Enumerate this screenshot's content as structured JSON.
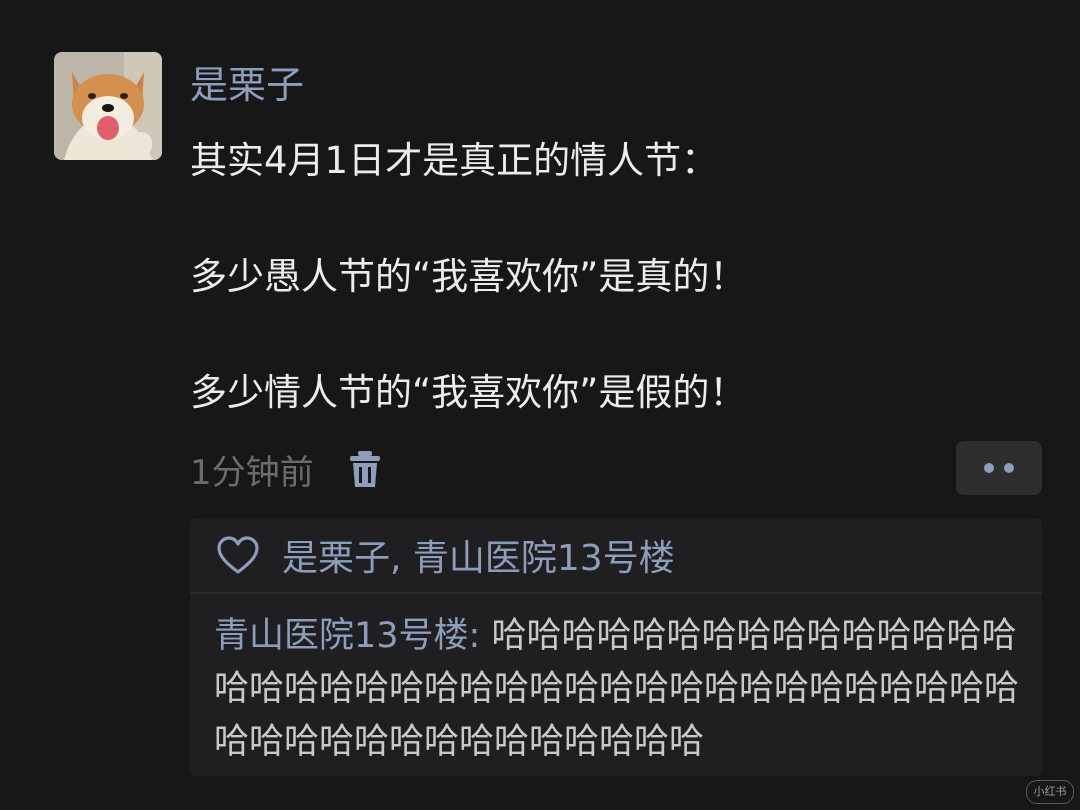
{
  "post": {
    "author": "是栗子",
    "lines": [
      "其实4月1日才是真正的情人节：",
      "",
      "多少愚人节的“我喜欢你”是真的！",
      "",
      "多少情人节的“我喜欢你”是假的！"
    ],
    "time": "1分钟前",
    "avatar_icon": "shiba-dog-avatar",
    "delete_icon": "trash-icon",
    "more_icon": "more-dots-icon"
  },
  "likes": {
    "icon": "heart-icon",
    "names": "是栗子, 青山医院13号楼"
  },
  "comment": {
    "author": "青山医院13号楼",
    "separator": ": ",
    "text": "哈哈哈哈哈哈哈哈哈哈哈哈哈哈哈哈哈哈哈哈哈哈哈哈哈哈哈哈哈哈哈哈哈哈哈哈哈哈哈哈哈哈哈哈哈哈哈哈哈哈哈哈"
  },
  "watermark": "小红书",
  "colors": {
    "background": "#171717",
    "name_blue": "#8d9dbb",
    "text": "#ececec",
    "muted": "#6c6c6c",
    "panel": "#1f1f21"
  }
}
